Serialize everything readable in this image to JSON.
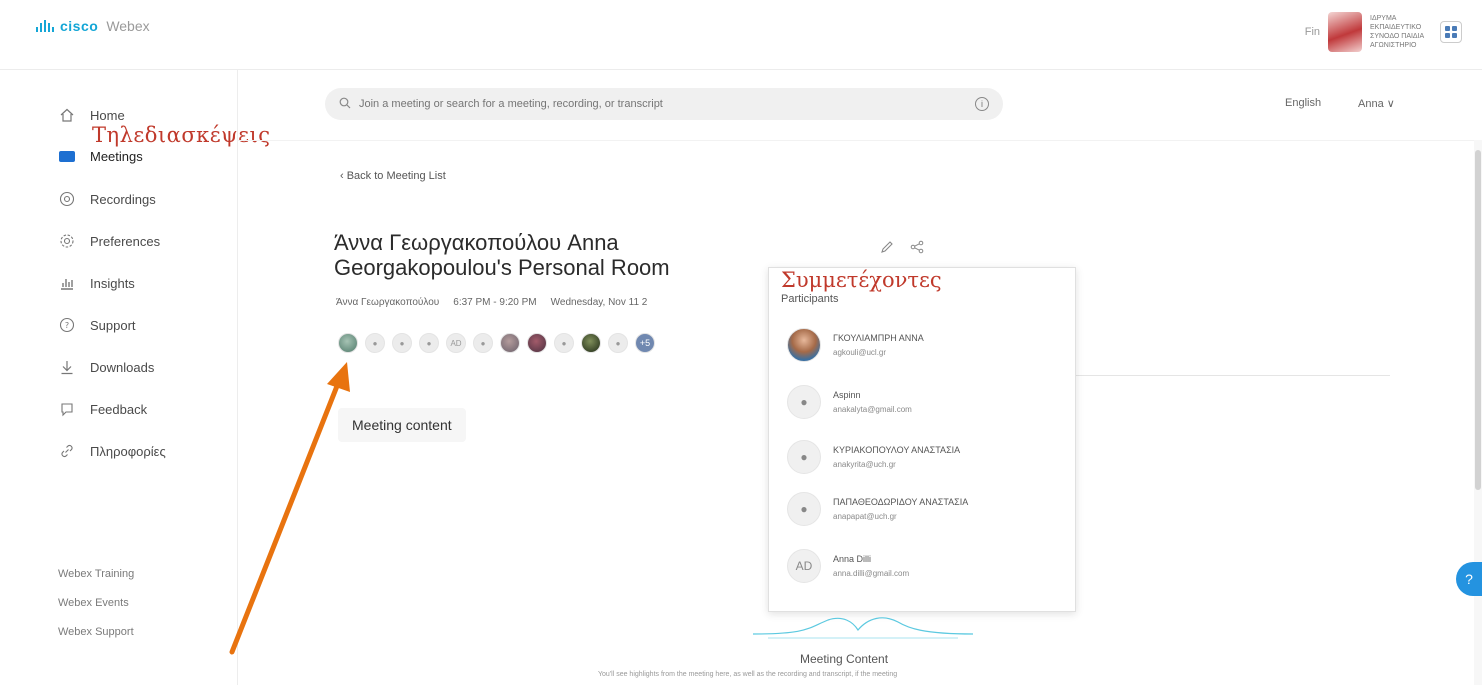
{
  "header": {
    "logo_cisco": "cisco",
    "logo_webex": "Webex",
    "user_fn": "Fin",
    "org_text": "ΙΔΡΥΜΑ ΕΚΠΑΙΔΕΥΤΙΚΟ ΣΥΝΟΔΟ ΠΑΙΔΙΑ ΑΓΩΝΙΣΤΗΡΙΟ"
  },
  "sidebar": {
    "items": [
      {
        "label": "Home",
        "icon": "home-icon"
      },
      {
        "label": "Meetings",
        "icon": "meetings-icon"
      },
      {
        "label": "Recordings",
        "icon": "recordings-icon"
      },
      {
        "label": "Preferences",
        "icon": "gear-icon"
      },
      {
        "label": "Insights",
        "icon": "insights-icon"
      },
      {
        "label": "Support",
        "icon": "support-icon"
      },
      {
        "label": "Downloads",
        "icon": "download-icon"
      },
      {
        "label": "Feedback",
        "icon": "feedback-icon"
      },
      {
        "label": "Πληροφορίες",
        "icon": "link-icon"
      }
    ],
    "annotation": "Τηλεδιασκέψεις",
    "footer_links": [
      "Webex Training",
      "Webex Events",
      "Webex Support"
    ]
  },
  "search": {
    "placeholder": "Join a meeting or search for a meeting, recording, or transcript"
  },
  "top_controls": {
    "language": "English",
    "user": "Anna ∨"
  },
  "meeting": {
    "back_link": "‹ Back to Meeting List",
    "title": "Άννα Γεωργακοπούλου Anna Georgakopoulou's Personal Room",
    "host": "Άννα Γεωργακοπούλου",
    "time": "6:37 PM - 9:20 PM",
    "date": "Wednesday, Nov 11 2",
    "avatar_initials": "AD",
    "more_label": "+5",
    "content_tab": "Meeting content"
  },
  "participants_popup": {
    "annotation": "Συμμετέχοντες",
    "header": "Participants",
    "people": [
      {
        "name": "ΓΚΟΥΛΙΑΜΠΡΗ ΑΝΝΑ",
        "email": "agkouli@ucl.gr",
        "avatar": "photo"
      },
      {
        "name": "Aspinn",
        "email": "anakalyta@gmail.com",
        "avatar": "generic"
      },
      {
        "name": "ΚΥΡΙΑΚΟΠΟΥΛΟΥ ΑΝΑΣΤΑΣΙΑ",
        "email": "anakyrita@uch.gr",
        "avatar": "generic"
      },
      {
        "name": "ΠΑΠΑΘΕΟΔΩΡΙΔΟΥ ΑΝΑΣΤΑΣΙΑ",
        "email": "anapapat@uch.gr",
        "avatar": "generic"
      },
      {
        "name": "Anna Dilli",
        "email": "anna.dilli@gmail.com",
        "avatar": "AD"
      }
    ]
  },
  "bottom": {
    "title": "Meeting Content",
    "description": "You'll see highlights from the meeting here, as well as the recording and transcript, if the meeting"
  },
  "help": "?",
  "colors": {
    "accent": "#1d6fd1",
    "annotation_red": "#c0392b",
    "arrow_orange": "#e8730f",
    "cisco_blue": "#14a6d6"
  }
}
